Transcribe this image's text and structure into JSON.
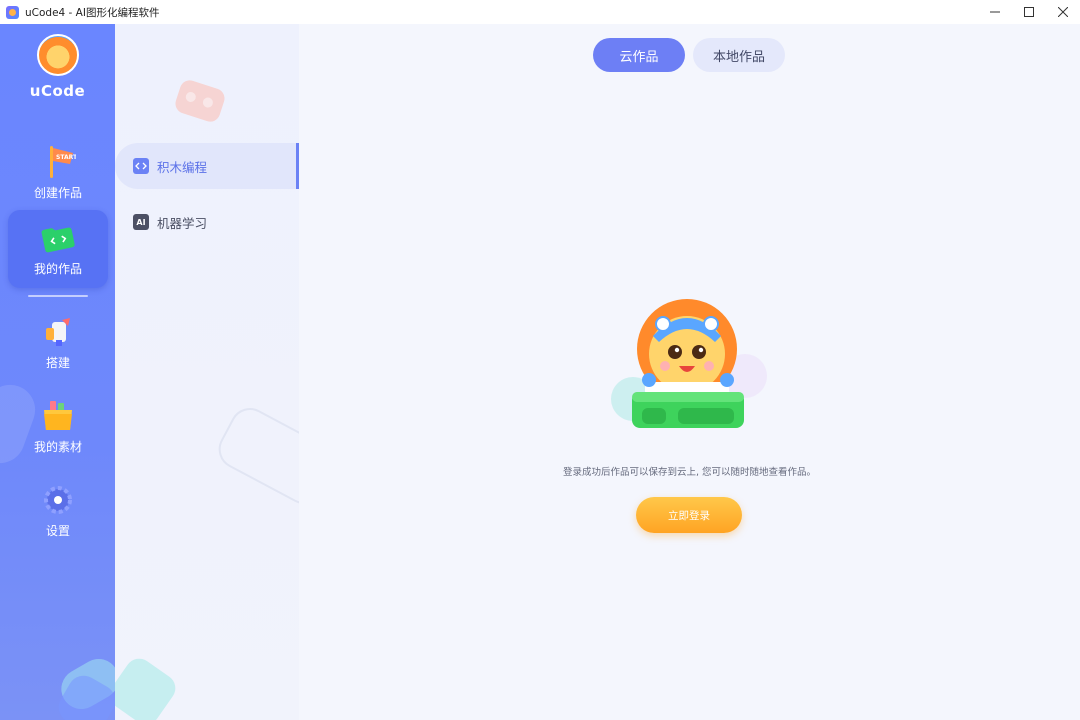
{
  "window": {
    "title": "uCode4 - AI图形化编程软件",
    "controls": [
      "minimize-icon",
      "maximize-icon",
      "close-icon"
    ]
  },
  "brand": {
    "name": "uCode"
  },
  "nav": {
    "items": [
      {
        "label": "创建作品",
        "icon": "start-flag-icon"
      },
      {
        "label": "我的作品",
        "icon": "folder-code-icon",
        "active": true
      },
      {
        "label": "搭建",
        "icon": "rocket-icon"
      },
      {
        "label": "我的素材",
        "icon": "material-folder-icon"
      },
      {
        "label": "设置",
        "icon": "gear-icon"
      }
    ]
  },
  "subnav": {
    "items": [
      {
        "label": "积木编程",
        "icon": "code-block-icon",
        "active": true
      },
      {
        "label": "机器学习",
        "icon": "ai-icon",
        "icon_text": "AI"
      }
    ]
  },
  "main": {
    "tabs": [
      {
        "label": "云作品",
        "active": true
      },
      {
        "label": "本地作品",
        "active": false
      }
    ],
    "empty_message": "登录成功后作品可以保存到云上, 您可以随时随地查看作品。",
    "login_button": "立即登录"
  },
  "colors": {
    "nav_bg": "#6a86ff",
    "accent": "#6d7ff5",
    "login_button": "#ffa423",
    "subnav_active": "#5b71e8"
  }
}
